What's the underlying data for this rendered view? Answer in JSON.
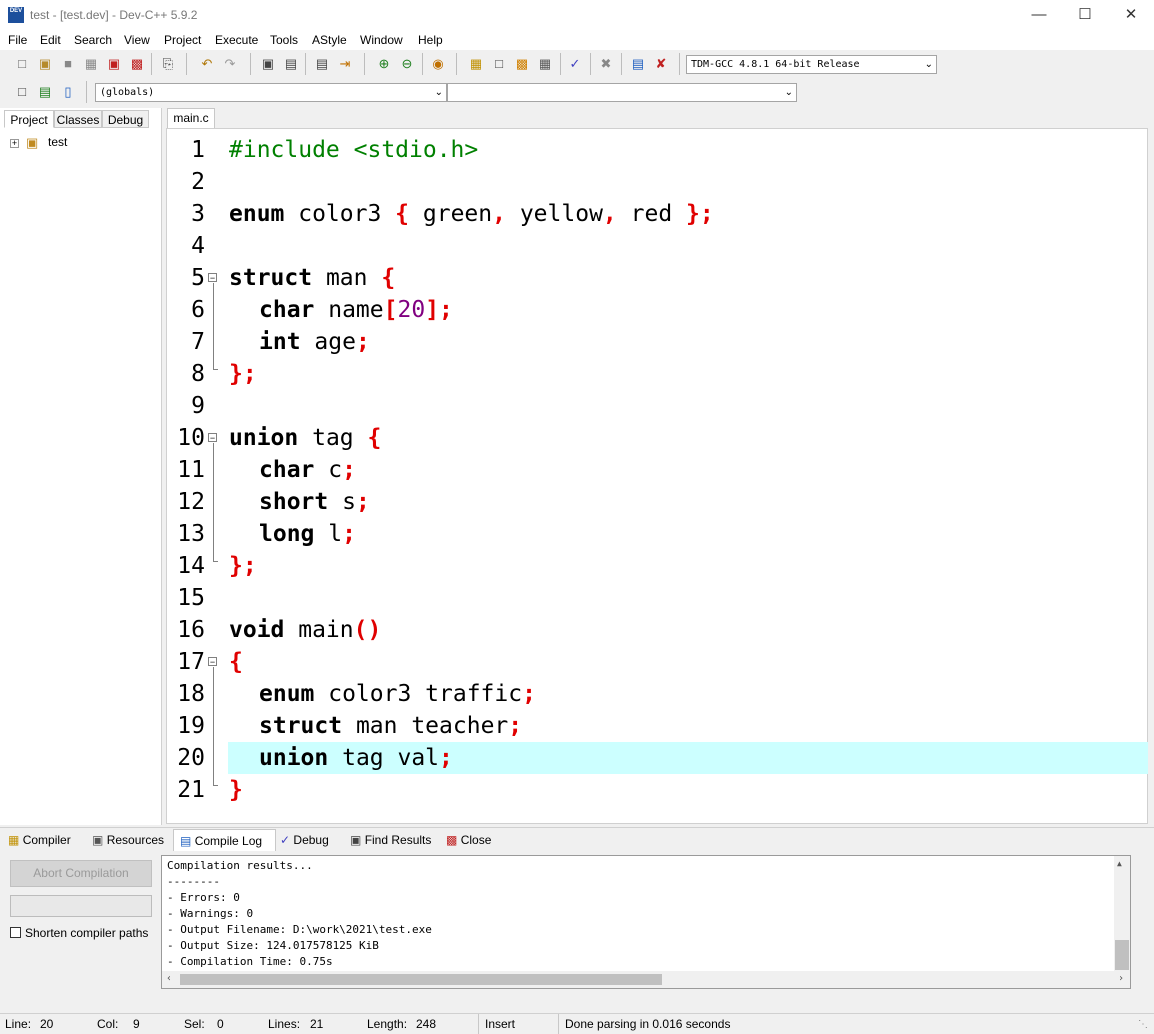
{
  "window": {
    "title": "test - [test.dev] - Dev-C++ 5.9.2",
    "icon_text": "DEV"
  },
  "menu": [
    "File",
    "Edit",
    "Search",
    "View",
    "Project",
    "Execute",
    "Tools",
    "AStyle",
    "Window",
    "Help"
  ],
  "toolbar": {
    "compiler_select": "TDM-GCC 4.8.1 64-bit Release",
    "scope_select": "(globals)",
    "function_select": ""
  },
  "left_panel": {
    "tabs": [
      "Project",
      "Classes",
      "Debug"
    ],
    "tree_root": "test"
  },
  "editor": {
    "tab": "main.c",
    "highlighted_line": 20,
    "lines": [
      {
        "n": "1"
      },
      {
        "n": "2"
      },
      {
        "n": "3"
      },
      {
        "n": "4"
      },
      {
        "n": "5"
      },
      {
        "n": "6"
      },
      {
        "n": "7"
      },
      {
        "n": "8"
      },
      {
        "n": "9"
      },
      {
        "n": "10"
      },
      {
        "n": "11"
      },
      {
        "n": "12"
      },
      {
        "n": "13"
      },
      {
        "n": "14"
      },
      {
        "n": "15"
      },
      {
        "n": "16"
      },
      {
        "n": "17"
      },
      {
        "n": "18"
      },
      {
        "n": "19"
      },
      {
        "n": "20"
      },
      {
        "n": "21"
      }
    ],
    "code": {
      "l1": "#include <stdio.h>",
      "l3a": "enum",
      "l3b": " color3 ",
      "l3c": "{",
      "l3d": " green",
      "l3e": ",",
      "l3f": " yellow",
      "l3g": ",",
      "l3h": " red ",
      "l3i": "};",
      "l5a": "struct",
      "l5b": " man ",
      "l5c": "{",
      "l6a": "char",
      "l6b": " name",
      "l6c": "[",
      "l6d": "20",
      "l6e": "];",
      "l7a": "int",
      "l7b": " age",
      "l7c": ";",
      "l8": "};",
      "l10a": "union",
      "l10b": " tag ",
      "l10c": "{",
      "l11a": "char",
      "l11b": " c",
      "l11c": ";",
      "l12a": "short",
      "l12b": " s",
      "l12c": ";",
      "l13a": "long",
      "l13b": " l",
      "l13c": ";",
      "l14": "};",
      "l16a": "void",
      "l16b": " main",
      "l16c": "()",
      "l17": "{",
      "l18a": "enum",
      "l18b": " color3 traffic",
      "l18c": ";",
      "l19a": "struct",
      "l19b": " man teacher",
      "l19c": ";",
      "l20a": "union",
      "l20b": " tag val",
      "l20c": ";",
      "l21": "}"
    }
  },
  "bottom_tabs": [
    "Compiler",
    "Resources",
    "Compile Log",
    "Debug",
    "Find Results",
    "Close"
  ],
  "compile_panel": {
    "abort_button": "Abort Compilation",
    "shorten_paths_label": "Shorten compiler paths",
    "shorten_paths_checked": false,
    "log": [
      "Compilation results...",
      "--------",
      "- Errors: 0",
      "- Warnings: 0",
      "- Output Filename: D:\\work\\2021\\test.exe",
      "- Output Size: 124.017578125 KiB",
      "- Compilation Time: 0.75s"
    ]
  },
  "status": {
    "line_label": "Line:",
    "line": "20",
    "col_label": "Col:",
    "col": "9",
    "sel_label": "Sel:",
    "sel": "0",
    "lines_label": "Lines:",
    "lines": "21",
    "length_label": "Length:",
    "length": "248",
    "mode": "Insert",
    "message": "Done parsing in 0.016 seconds"
  }
}
